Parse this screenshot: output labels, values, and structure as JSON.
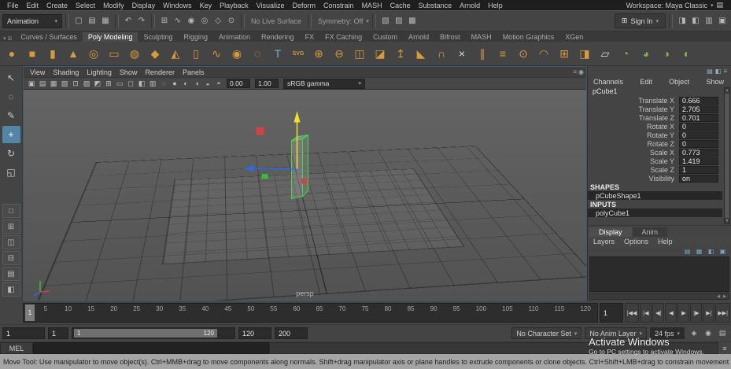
{
  "colors": {
    "accent": "#5285a6",
    "gold": "#d79a3c",
    "green": "#87b145",
    "blue": "#6db3d9",
    "red": "#cc4444",
    "manip_yellow": "#efe32a",
    "manip_blue": "#2f6bdf",
    "manip_green": "#35c135",
    "wire_green": "#44d944",
    "watermark": "#ffffff"
  },
  "glyphs": {
    "caret": "▾"
  },
  "menubar": {
    "items": [
      {
        "label": "File"
      },
      {
        "label": "Edit"
      },
      {
        "label": "Create"
      },
      {
        "label": "Select"
      },
      {
        "label": "Modify"
      },
      {
        "label": "Display"
      },
      {
        "label": "Windows"
      },
      {
        "label": "Key"
      },
      {
        "label": "Playback"
      },
      {
        "label": "Visualize"
      },
      {
        "label": "Deform"
      },
      {
        "label": "Constrain"
      },
      {
        "label": "MASH"
      },
      {
        "label": "Cache"
      },
      {
        "label": "Substance"
      },
      {
        "label": "Arnold"
      },
      {
        "label": "Help"
      }
    ],
    "workspace_label": "Workspace: Maya Classic",
    "workspace_icon": "▤"
  },
  "statusline": {
    "mode": "Animation",
    "no_live_surface": "No Live Surface",
    "symmetry": "Symmetry: Off",
    "icons_file": [
      {
        "name": "new-scene-icon",
        "glyph": "▢"
      },
      {
        "name": "open-scene-icon",
        "glyph": "▤"
      },
      {
        "name": "save-scene-icon",
        "glyph": "▦"
      }
    ],
    "icons_edit": [
      {
        "name": "undo-icon",
        "glyph": "↶"
      },
      {
        "name": "redo-icon",
        "glyph": "↷"
      }
    ],
    "icons_snap": [
      {
        "name": "snap-to-grid-icon",
        "glyph": "⊞"
      },
      {
        "name": "snap-to-curve-icon",
        "glyph": "∿"
      },
      {
        "name": "snap-to-point-icon",
        "glyph": "◉"
      },
      {
        "name": "snap-to-projected-center-icon",
        "glyph": "◎"
      },
      {
        "name": "snap-to-view-plane-icon",
        "glyph": "◇"
      },
      {
        "name": "make-live-icon",
        "glyph": "⊙"
      }
    ],
    "icons_render": [
      {
        "name": "render-view-icon",
        "glyph": "▧"
      },
      {
        "name": "ipr-render-icon",
        "glyph": "▨"
      },
      {
        "name": "render-settings-icon",
        "glyph": "▩"
      }
    ],
    "sign_in": {
      "label": "Sign In",
      "icon_glyph": "⊞"
    },
    "icons_panels": [
      {
        "name": "attribute-editor-toggle-icon",
        "glyph": "◨"
      },
      {
        "name": "tool-settings-toggle-icon",
        "glyph": "◧"
      },
      {
        "name": "channel-box-toggle-icon",
        "glyph": "▥"
      },
      {
        "name": "modeling-toolkit-toggle-icon",
        "glyph": "▣"
      }
    ]
  },
  "shelf": {
    "corner_icons": [
      {
        "name": "shelf-tab-menu-icon",
        "glyph": "▾"
      },
      {
        "name": "shelf-options-icon",
        "glyph": "⊞"
      }
    ],
    "tabs": [
      {
        "label": "Curves / Surfaces"
      },
      {
        "label": "Poly Modeling",
        "active": true
      },
      {
        "label": "Sculpting"
      },
      {
        "label": "Rigging"
      },
      {
        "label": "Animation"
      },
      {
        "label": "Rendering"
      },
      {
        "label": "FX"
      },
      {
        "label": "FX Caching"
      },
      {
        "label": "Custom"
      },
      {
        "label": "Arnold"
      },
      {
        "label": "Bifrost"
      },
      {
        "label": "MASH"
      },
      {
        "label": "Motion Graphics"
      },
      {
        "label": "XGen"
      }
    ],
    "icons": [
      {
        "name": "shelf-icon-poly-sphere",
        "glyph": "●",
        "tone": "gold"
      },
      {
        "name": "shelf-icon-poly-cube",
        "glyph": "■",
        "tone": "gold"
      },
      {
        "name": "shelf-icon-poly-cylinder",
        "glyph": "▮",
        "tone": "gold"
      },
      {
        "name": "shelf-icon-poly-cone",
        "glyph": "▲",
        "tone": "gold"
      },
      {
        "name": "shelf-icon-poly-torus",
        "glyph": "◎",
        "tone": "gold"
      },
      {
        "name": "shelf-icon-poly-plane",
        "glyph": "▭",
        "tone": "gold"
      },
      {
        "name": "shelf-icon-poly-disc",
        "glyph": "◍",
        "tone": "gold"
      },
      {
        "name": "shelf-icon-platonic-solid",
        "glyph": "◆",
        "tone": "gold"
      },
      {
        "name": "shelf-icon-poly-pyramid",
        "glyph": "◭",
        "tone": "gold"
      },
      {
        "name": "shelf-icon-poly-pipe",
        "glyph": "▯",
        "tone": "gold"
      },
      {
        "name": "shelf-icon-poly-helix",
        "glyph": "∿",
        "tone": "gold"
      },
      {
        "name": "shelf-icon-poly-gear",
        "glyph": "◉",
        "tone": "gold"
      },
      {
        "name": "shelf-icon-poly-soccer-ball",
        "glyph": "◌",
        "tone": "gold"
      },
      {
        "name": "shelf-icon-type-tool",
        "glyph": "T",
        "tone": "blue"
      },
      {
        "name": "shelf-icon-svg-tool",
        "glyph": "SVG",
        "tone": "gold"
      },
      {
        "name": "shelf-icon-boolean-union",
        "glyph": "⊕",
        "tone": "gold"
      },
      {
        "name": "shelf-icon-boolean-difference",
        "glyph": "⊖",
        "tone": "gold"
      },
      {
        "name": "shelf-icon-combine",
        "glyph": "◫",
        "tone": "gold"
      },
      {
        "name": "shelf-icon-separate",
        "glyph": "◪",
        "tone": "gold"
      },
      {
        "name": "shelf-icon-extrude",
        "glyph": "↥",
        "tone": "gold"
      },
      {
        "name": "shelf-icon-bevel",
        "glyph": "◣",
        "tone": "gold"
      },
      {
        "name": "shelf-icon-bridge",
        "glyph": "∩",
        "tone": "gold"
      },
      {
        "name": "shelf-icon-multi-cut",
        "glyph": "×",
        "tone": "white"
      },
      {
        "name": "shelf-icon-insert-edge-loop",
        "glyph": "∥",
        "tone": "gold"
      },
      {
        "name": "shelf-icon-offset-edge-loop",
        "glyph": "≡",
        "tone": "gold"
      },
      {
        "name": "shelf-icon-merge-vertices",
        "glyph": "⊙",
        "tone": "gold"
      },
      {
        "name": "shelf-icon-smooth",
        "glyph": "◠",
        "tone": "gold"
      },
      {
        "name": "shelf-icon-subdivide",
        "glyph": "⊞",
        "tone": "gold"
      },
      {
        "name": "shelf-icon-mirror",
        "glyph": "◨",
        "tone": "gold"
      },
      {
        "name": "shelf-icon-quad-draw",
        "glyph": "▱",
        "tone": "white"
      },
      {
        "name": "shelf-icon-sculpt-brush",
        "glyph": "◔",
        "tone": "green"
      },
      {
        "name": "shelf-icon-sculpt-smooth",
        "glyph": "◕",
        "tone": "green"
      },
      {
        "name": "shelf-icon-sculpt-grab",
        "glyph": "◑",
        "tone": "green"
      },
      {
        "name": "shelf-icon-sculpt-pinch",
        "glyph": "◐",
        "tone": "green"
      }
    ]
  },
  "toolbox": {
    "tools": [
      {
        "name": "select-tool",
        "glyph": "↖"
      },
      {
        "name": "lasso-select-tool",
        "glyph": "◌"
      },
      {
        "name": "paint-select-tool",
        "glyph": "✎"
      },
      {
        "name": "move-tool",
        "glyph": "+",
        "active": true
      },
      {
        "name": "rotate-tool",
        "glyph": "↻"
      },
      {
        "name": "scale-tool",
        "glyph": "◱"
      }
    ],
    "layouts": [
      {
        "name": "layout-single-pane",
        "glyph": "□"
      },
      {
        "name": "layout-four-pane",
        "glyph": "⊞"
      },
      {
        "name": "layout-two-side-by-side",
        "glyph": "◫"
      },
      {
        "name": "layout-two-stacked",
        "glyph": "⊟"
      },
      {
        "name": "layout-three-split",
        "glyph": "▤"
      },
      {
        "name": "layout-outliner-persp",
        "glyph": "◧"
      }
    ]
  },
  "viewport": {
    "menus": [
      {
        "label": "View"
      },
      {
        "label": "Shading"
      },
      {
        "label": "Lighting"
      },
      {
        "label": "Show"
      },
      {
        "label": "Renderer"
      },
      {
        "label": "Panels"
      }
    ],
    "menu_right_icons": [
      {
        "name": "panel-menu-icon",
        "glyph": "≡"
      },
      {
        "name": "panel-pin-icon",
        "glyph": "◉"
      }
    ],
    "toolbar_icons": [
      {
        "name": "lock-camera-icon",
        "glyph": "▣"
      },
      {
        "name": "camera-attributes-icon",
        "glyph": "▤"
      },
      {
        "name": "bookmarks-icon",
        "glyph": "▦"
      },
      {
        "name": "image-plane-icon",
        "glyph": "▧"
      },
      {
        "name": "two-d-pan-zoom-icon",
        "glyph": "⊡"
      },
      {
        "name": "oversampling-icon",
        "glyph": "▨"
      },
      {
        "name": "isolate-select-icon",
        "glyph": "◩"
      },
      {
        "name": "grid-toggle-icon",
        "glyph": "⊞"
      },
      {
        "name": "film-gate-icon",
        "glyph": "▭"
      },
      {
        "name": "resolution-gate-icon",
        "glyph": "◻"
      },
      {
        "name": "gate-mask-icon",
        "glyph": "◧"
      },
      {
        "name": "field-chart-icon",
        "glyph": "▥"
      },
      {
        "name": "wireframe-icon",
        "glyph": "◌"
      },
      {
        "name": "shaded-icon",
        "glyph": "●"
      },
      {
        "name": "textured-icon",
        "glyph": "◐"
      },
      {
        "name": "lighting-icon",
        "glyph": "◑"
      },
      {
        "name": "shadows-icon",
        "glyph": "◒"
      },
      {
        "name": "xray-icon",
        "glyph": "◓"
      }
    ],
    "exposure": "0.00",
    "gamma": "1.00",
    "view_transform": "sRGB gamma",
    "camera_label": "persp"
  },
  "channelbox": {
    "corner_icons": [
      {
        "name": "channel-stats-icon",
        "glyph": "▤"
      },
      {
        "name": "slider-mode-icon",
        "glyph": "◧"
      },
      {
        "name": "channel-settings-icon",
        "glyph": "≡"
      }
    ],
    "menus": [
      {
        "label": "Channels"
      },
      {
        "label": "Edit"
      },
      {
        "label": "Object"
      },
      {
        "label": "Show"
      }
    ],
    "object_name": "pCube1",
    "attributes": [
      {
        "label": "Translate X",
        "value": "0.666"
      },
      {
        "label": "Translate Y",
        "value": "2.705"
      },
      {
        "label": "Translate Z",
        "value": "0.701"
      },
      {
        "label": "Rotate X",
        "value": "0"
      },
      {
        "label": "Rotate Y",
        "value": "0"
      },
      {
        "label": "Rotate Z",
        "value": "0"
      },
      {
        "label": "Scale X",
        "value": "0.773"
      },
      {
        "label": "Scale Y",
        "value": "1.419"
      },
      {
        "label": "Scale Z",
        "value": "1"
      },
      {
        "label": "Visibility",
        "value": "on"
      }
    ],
    "shapes_header": "SHAPES",
    "shape_item": "pCubeShape1",
    "inputs_header": "INPUTS",
    "input_item": "polyCube1"
  },
  "layer_panel": {
    "tabs": [
      {
        "label": "Display",
        "active": true
      },
      {
        "label": "Anim"
      }
    ],
    "menus": [
      {
        "label": "Layers"
      },
      {
        "label": "Options"
      },
      {
        "label": "Help"
      }
    ],
    "toolbar_icons": [
      {
        "name": "create-empty-layer-icon",
        "glyph": "▤"
      },
      {
        "name": "create-layer-from-selected-icon",
        "glyph": "▦"
      },
      {
        "name": "create-override-layer-icon",
        "glyph": "◧"
      },
      {
        "name": "layer-options-icon",
        "glyph": "▣"
      }
    ]
  },
  "timeslider": {
    "current_frame": "1",
    "ticks": [
      {
        "t": "5"
      },
      {
        "t": "10"
      },
      {
        "t": "15"
      },
      {
        "t": "20"
      },
      {
        "t": "25"
      },
      {
        "t": "30"
      },
      {
        "t": "35"
      },
      {
        "t": "40"
      },
      {
        "t": "45"
      },
      {
        "t": "50"
      },
      {
        "t": "55"
      },
      {
        "t": "60"
      },
      {
        "t": "65"
      },
      {
        "t": "70"
      },
      {
        "t": "75"
      },
      {
        "t": "80"
      },
      {
        "t": "85"
      },
      {
        "t": "90"
      },
      {
        "t": "95"
      },
      {
        "t": "100"
      },
      {
        "t": "105"
      },
      {
        "t": "110"
      },
      {
        "t": "115"
      },
      {
        "t": "120"
      }
    ],
    "frame_field": "1",
    "playback": [
      {
        "name": "go-to-start-button",
        "glyph": "|◀◀"
      },
      {
        "name": "step-back-key-button",
        "glyph": "|◀"
      },
      {
        "name": "step-back-frame-button",
        "glyph": "◀|"
      },
      {
        "name": "play-backwards-button",
        "glyph": "◀"
      },
      {
        "name": "play-forwards-button",
        "glyph": "▶"
      },
      {
        "name": "step-forward-frame-button",
        "glyph": "|▶"
      },
      {
        "name": "step-forward-key-button",
        "glyph": "▶|"
      },
      {
        "name": "go-to-end-button",
        "glyph": "▶▶|"
      }
    ]
  },
  "rangeslider": {
    "anim_start": "1",
    "playback_start": "1",
    "bar_start_label": "1",
    "bar_end_label": "120",
    "playback_end": "120",
    "anim_end": "200",
    "character_set": "No Character Set",
    "anim_layer": "No Anim Layer",
    "fps": "24 fps",
    "right_icons": [
      {
        "name": "anim-snap-icon",
        "glyph": "◈"
      },
      {
        "name": "auto-keyframe-icon",
        "glyph": "◉",
        "tone": "red"
      },
      {
        "name": "animation-preferences-icon",
        "glyph": "▤"
      }
    ]
  },
  "commandline": {
    "label": "MEL",
    "history_icon": "≡"
  },
  "helpline": {
    "text": "Move Tool: Use manipulator to move object(s). Ctrl+MMB+drag to move components along normals. Shift+drag manipulator axis or plane handles to extrude components or clone objects. Ctrl+Shift+LMB+drag to constrain movement to a connected edge. Use D or INSERT to change the pivot position"
  },
  "watermark": {
    "line1": "Activate Windows",
    "line2": "Go to PC settings to activate Windows."
  }
}
